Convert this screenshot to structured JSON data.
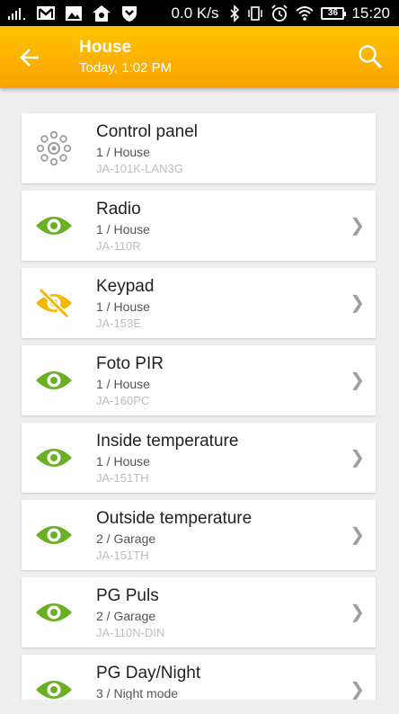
{
  "status_bar": {
    "net_speed": "0.0 K/s",
    "battery": "36",
    "time": "15:20",
    "icons": [
      "signal-icon",
      "gmail-icon",
      "image-icon",
      "home-icon",
      "shield-icon",
      "bluetooth-icon",
      "vibrate-icon",
      "alarm-icon",
      "wifi-icon",
      "battery-icon"
    ]
  },
  "app_bar": {
    "title": "House",
    "subtitle": "Today, 1:02 PM",
    "back_icon": "arrow-back-icon",
    "search_icon": "search-icon"
  },
  "colors": {
    "accent": "#f9a800",
    "ok_icon": "#6ab023",
    "warn_icon": "#f5b800",
    "panel_icon": "#9e9e9e"
  },
  "devices": [
    {
      "name": "Control panel",
      "location": "1 / House",
      "model": "JA-101K-LAN3G",
      "icon": "control-panel-icon",
      "chevron": false
    },
    {
      "name": "Radio",
      "location": "1 / House",
      "model": "JA-110R",
      "icon": "eye-icon",
      "chevron": true
    },
    {
      "name": "Keypad",
      "location": "1 / House",
      "model": "JA-153E",
      "icon": "eye-off-icon",
      "chevron": true
    },
    {
      "name": "Foto PIR",
      "location": "1 / House",
      "model": "JA-160PC",
      "icon": "eye-icon",
      "chevron": true
    },
    {
      "name": "Inside temperature",
      "location": "1 / House",
      "model": "JA-151TH",
      "icon": "eye-icon",
      "chevron": true
    },
    {
      "name": "Outside temperature",
      "location": "2 / Garage",
      "model": "JA-151TH",
      "icon": "eye-icon",
      "chevron": true
    },
    {
      "name": "PG Puls",
      "location": "2 / Garage",
      "model": "JA-110N-DIN",
      "icon": "eye-icon",
      "chevron": true
    },
    {
      "name": "PG Day/Night",
      "location": "3 / Night mode",
      "model": "",
      "icon": "eye-icon",
      "chevron": true
    }
  ]
}
